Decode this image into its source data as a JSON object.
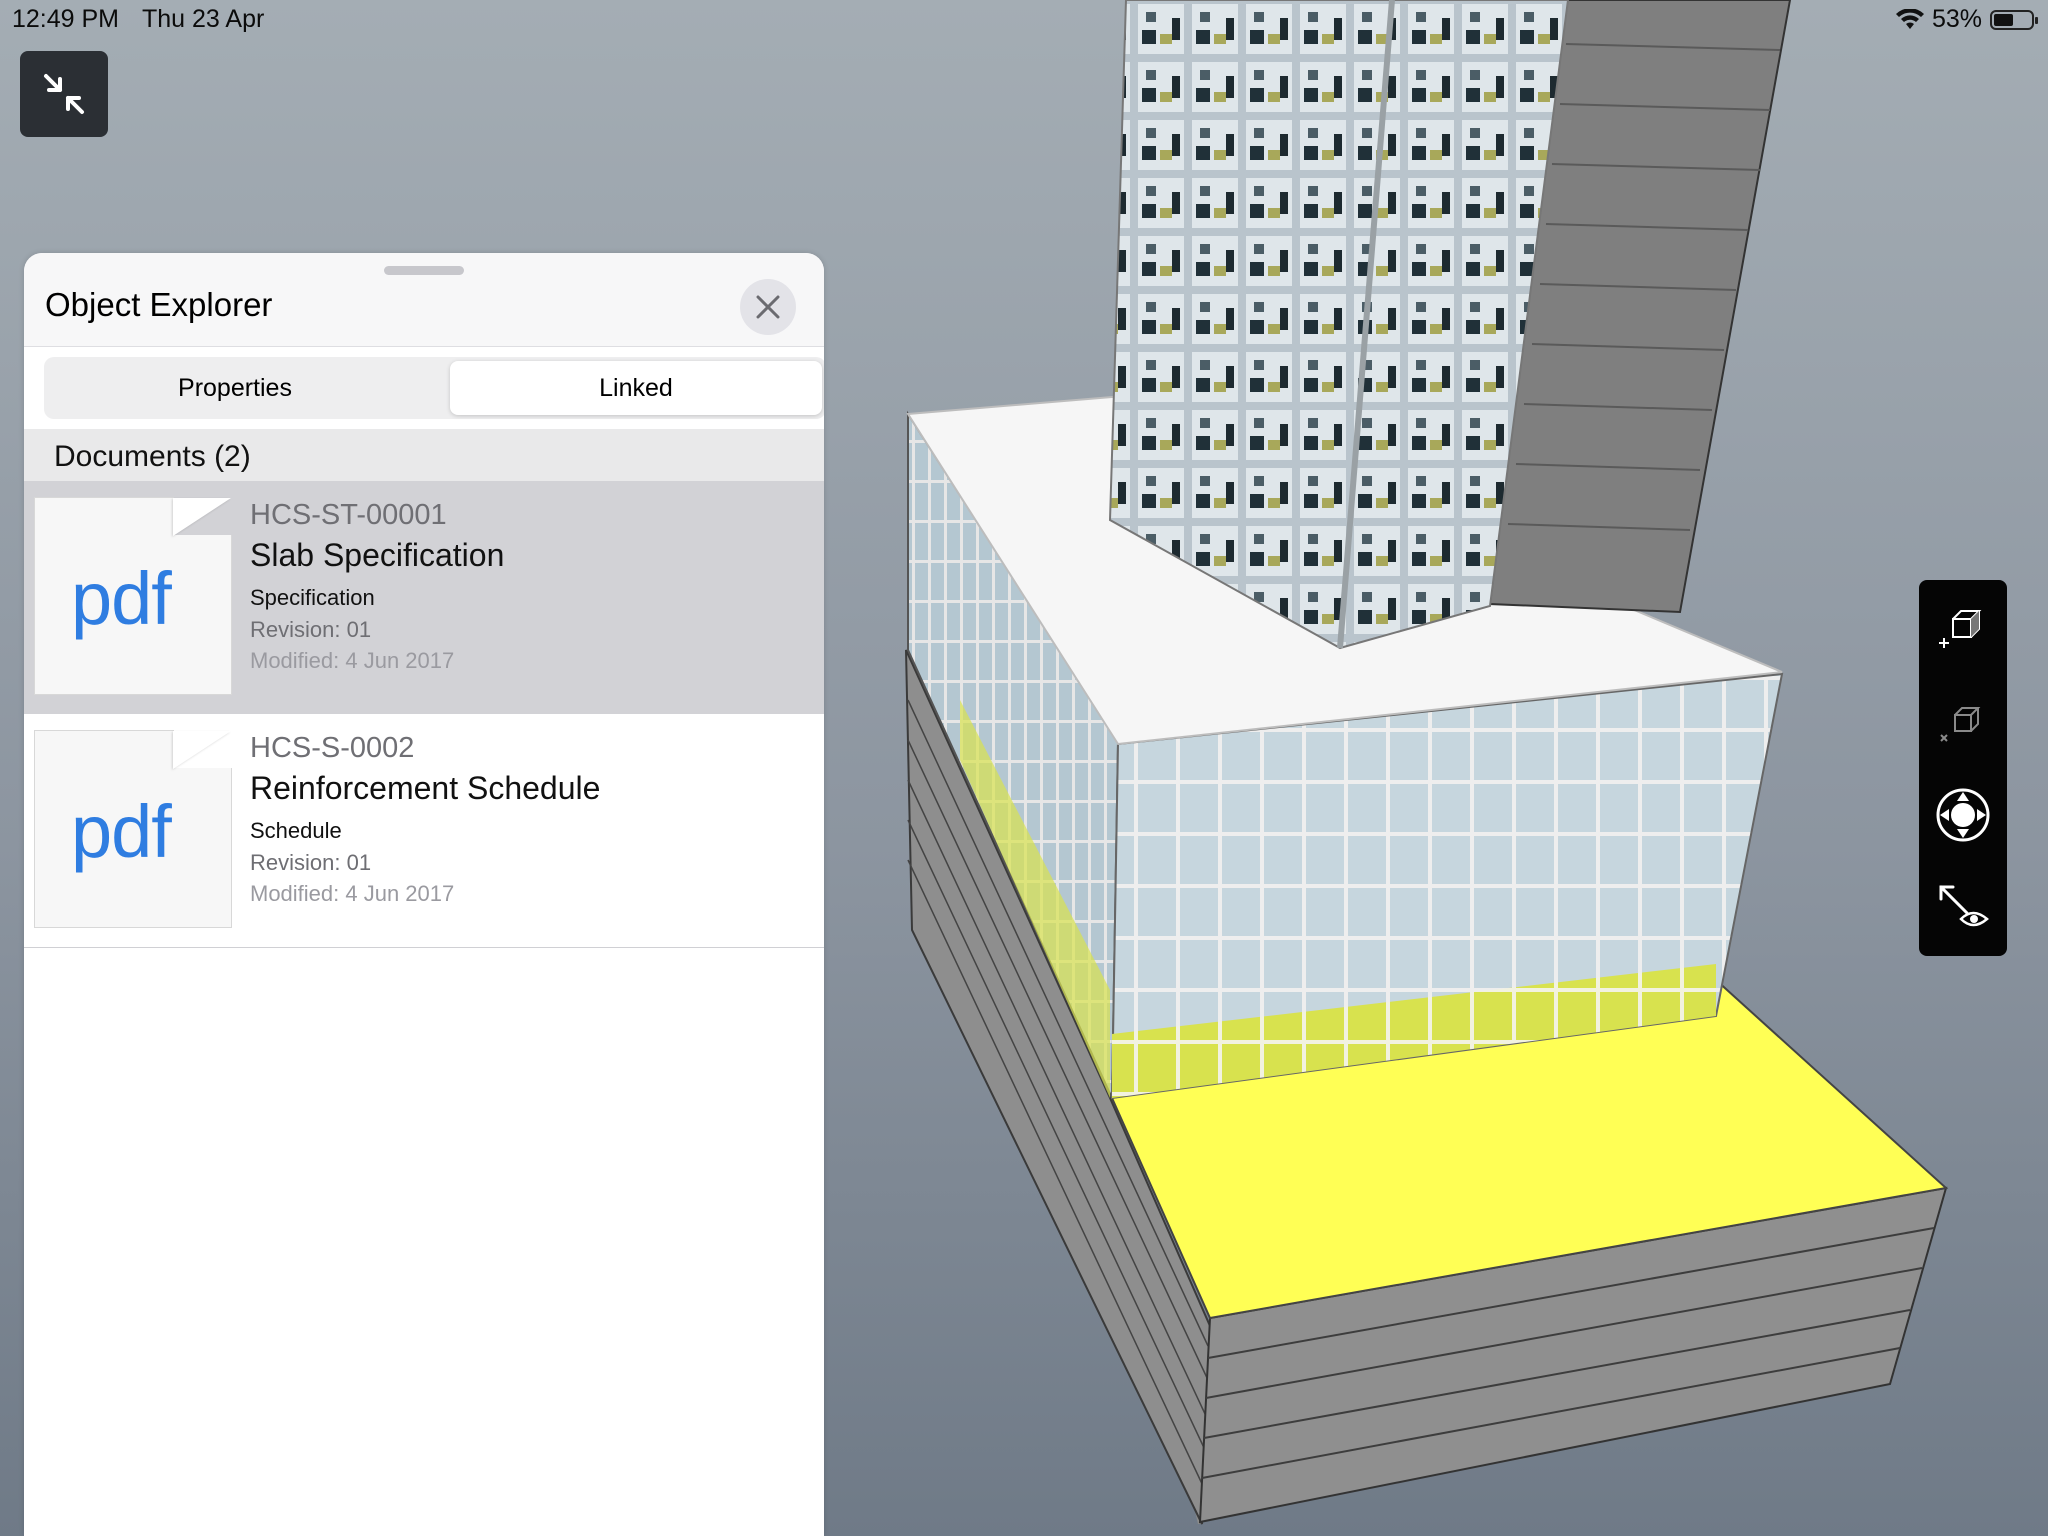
{
  "status_bar": {
    "time": "12:49 PM",
    "date": "Thu 23 Apr",
    "battery": "53%",
    "battery_level": 0.53
  },
  "viewer": {
    "collapse_icon": "collapse-arrows-icon"
  },
  "panel": {
    "title": "Object Explorer",
    "tabs": [
      {
        "label": "Properties",
        "selected": false
      },
      {
        "label": "Linked",
        "selected": true
      }
    ],
    "documents_header": "Documents (2)",
    "documents": [
      {
        "thumb_label": "pdf",
        "code": "HCS-ST-00001",
        "name": "Slab Specification",
        "type": "Specification",
        "revision": "Revision: 01",
        "modified": "Modified: 4 Jun 2017",
        "selected": true
      },
      {
        "thumb_label": "pdf",
        "code": "HCS-S-0002",
        "name": "Reinforcement Schedule",
        "type": "Schedule",
        "revision": "Revision: 01",
        "modified": "Modified: 4 Jun 2017",
        "selected": false
      }
    ]
  },
  "toolbar": {
    "tools": [
      "add-section-box-icon",
      "remove-section-box-icon",
      "orbit-navigation-icon",
      "look-around-icon"
    ]
  },
  "colors": {
    "accent": "#2f7de1",
    "highlight": "#ffff55",
    "selected_row": "#d2d2d6"
  }
}
